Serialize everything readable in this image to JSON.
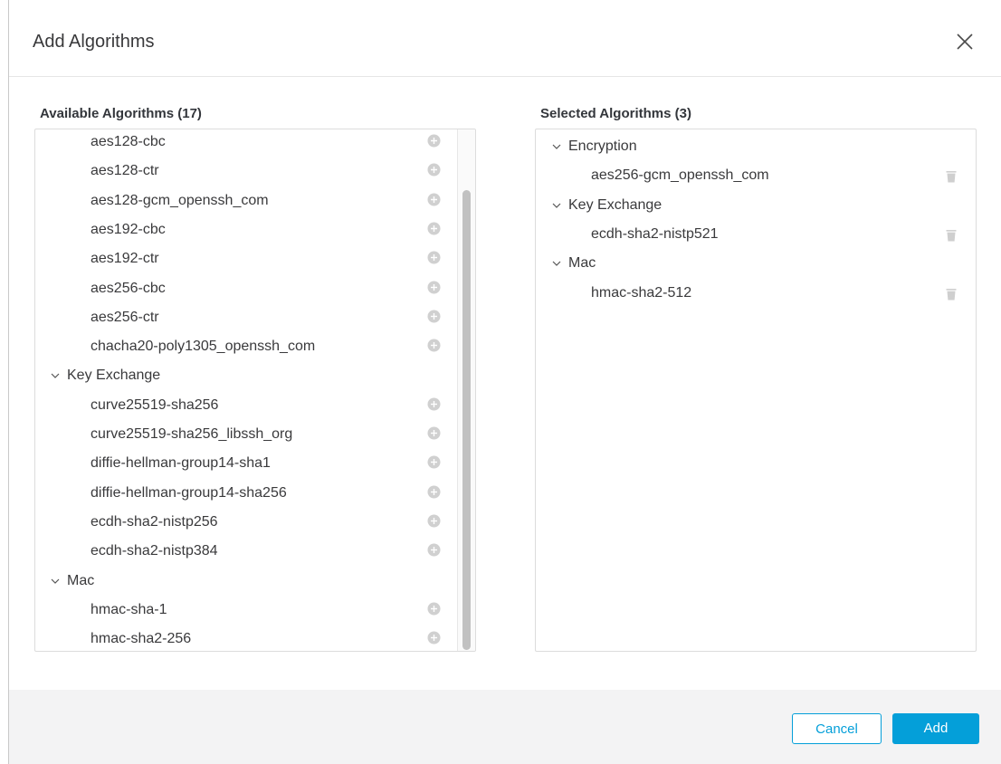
{
  "dialog": {
    "title": "Add Algorithms",
    "close_icon": "close-icon"
  },
  "available": {
    "title": "Available Algorithms (17)",
    "rows": [
      {
        "type": "item",
        "label": "aes128-cbc"
      },
      {
        "type": "item",
        "label": "aes128-ctr"
      },
      {
        "type": "item",
        "label": "aes128-gcm_openssh_com"
      },
      {
        "type": "item",
        "label": "aes192-cbc"
      },
      {
        "type": "item",
        "label": "aes192-ctr"
      },
      {
        "type": "item",
        "label": "aes256-cbc"
      },
      {
        "type": "item",
        "label": "aes256-ctr"
      },
      {
        "type": "item",
        "label": "chacha20-poly1305_openssh_com"
      },
      {
        "type": "group",
        "label": "Key Exchange",
        "expanded": true
      },
      {
        "type": "item",
        "label": "curve25519-sha256"
      },
      {
        "type": "item",
        "label": "curve25519-sha256_libssh_org"
      },
      {
        "type": "item",
        "label": "diffie-hellman-group14-sha1"
      },
      {
        "type": "item",
        "label": "diffie-hellman-group14-sha256"
      },
      {
        "type": "item",
        "label": "ecdh-sha2-nistp256"
      },
      {
        "type": "item",
        "label": "ecdh-sha2-nistp384"
      },
      {
        "type": "group",
        "label": "Mac",
        "expanded": true
      },
      {
        "type": "item",
        "label": "hmac-sha-1"
      },
      {
        "type": "item",
        "label": "hmac-sha2-256"
      }
    ],
    "item_icon": "plus-circle-icon",
    "scrollbar": {
      "visible_fraction": 0.88
    }
  },
  "selected": {
    "title": "Selected Algorithms (3)",
    "rows": [
      {
        "type": "group",
        "label": "Encryption",
        "expanded": true
      },
      {
        "type": "item",
        "label": "aes256-gcm_openssh_com"
      },
      {
        "type": "group",
        "label": "Key Exchange",
        "expanded": true
      },
      {
        "type": "item",
        "label": "ecdh-sha2-nistp521"
      },
      {
        "type": "group",
        "label": "Mac",
        "expanded": true
      },
      {
        "type": "item",
        "label": "hmac-sha2-512"
      }
    ],
    "item_icon": "trash-icon"
  },
  "footer": {
    "cancel_label": "Cancel",
    "add_label": "Add"
  },
  "colors": {
    "accent": "#049fd9",
    "footer_bg": "#f3f3f4",
    "icon_gray": "#d0d0d0"
  }
}
